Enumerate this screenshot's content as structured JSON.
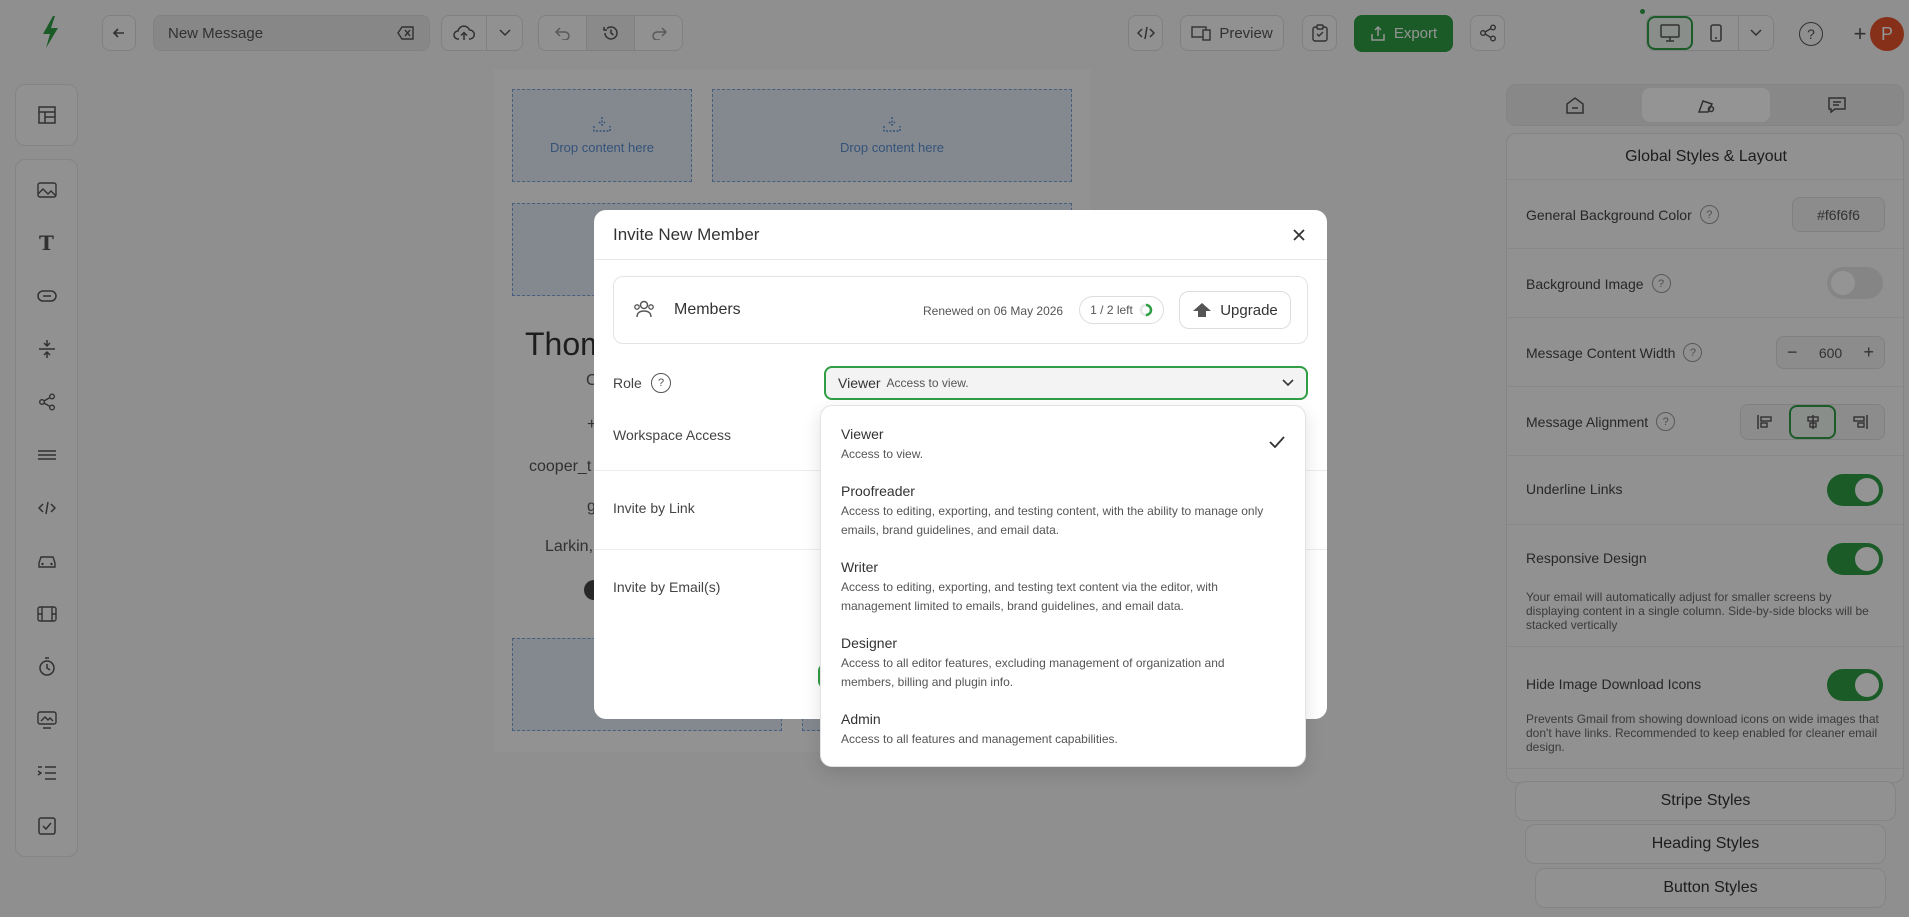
{
  "topbar": {
    "message_name": "New Message",
    "preview_label": "Preview",
    "export_label": "Export",
    "avatar_initial": "P"
  },
  "canvas": {
    "drop_label_1": "Drop content here",
    "drop_label_2": "Drop content here",
    "partial_texts": [
      "Thom",
      "C",
      "+",
      "cooper_t",
      "g",
      "Larkin,"
    ]
  },
  "right_panel": {
    "title": "Global Styles & Layout",
    "bg_color_label": "General Background Color",
    "bg_color_value": "#f6f6f6",
    "bg_image_label": "Background Image",
    "bg_image_on": false,
    "width_label": "Message Content Width",
    "width_value": "600",
    "alignment_label": "Message Alignment",
    "alignment_selected": "center",
    "underline_label": "Underline Links",
    "underline_on": true,
    "responsive_label": "Responsive Design",
    "responsive_on": true,
    "responsive_desc": "Your email will automatically adjust for smaller screens by displaying content in a single column. Side-by-side blocks will be stacked vertically",
    "hide_icons_label": "Hide Image Download Icons",
    "hide_icons_on": true,
    "hide_icons_desc": "Prevents Gmail from showing download icons on wide images that don't have links. Recommended to keep enabled for cleaner email design.",
    "sections": [
      "Stripe Styles",
      "Heading Styles",
      "Button Styles"
    ]
  },
  "modal": {
    "title": "Invite New Member",
    "members_label": "Members",
    "renewed_text": "Renewed on 06 May 2026",
    "seats_text": "1 / 2 left",
    "seats_used_fraction": 0.5,
    "upgrade_label": "Upgrade",
    "role_label": "Role",
    "role_selected": "Viewer",
    "role_selected_desc": "Access to view.",
    "workspace_label": "Workspace Access",
    "link_label": "Invite by Link",
    "email_label": "Invite by Email(s)"
  },
  "dropdown": {
    "items": [
      {
        "title": "Viewer",
        "desc": "Access to view.",
        "selected": true
      },
      {
        "title": "Proofreader",
        "desc": "Access to editing, exporting, and testing content, with the ability to manage only emails, brand guidelines, and email data."
      },
      {
        "title": "Writer",
        "desc": "Access to editing, exporting, and testing text content via the editor, with management limited to emails, brand guidelines, and email data."
      },
      {
        "title": "Designer",
        "desc": "Access to all editor features, excluding management of organization and members, billing and plugin info."
      },
      {
        "title": "Admin",
        "desc": "Access to all features and management capabilities."
      }
    ]
  },
  "colors": {
    "accent": "#2f9e44",
    "avatar": "#e8532b",
    "drop_zone": "#e4edf8"
  }
}
